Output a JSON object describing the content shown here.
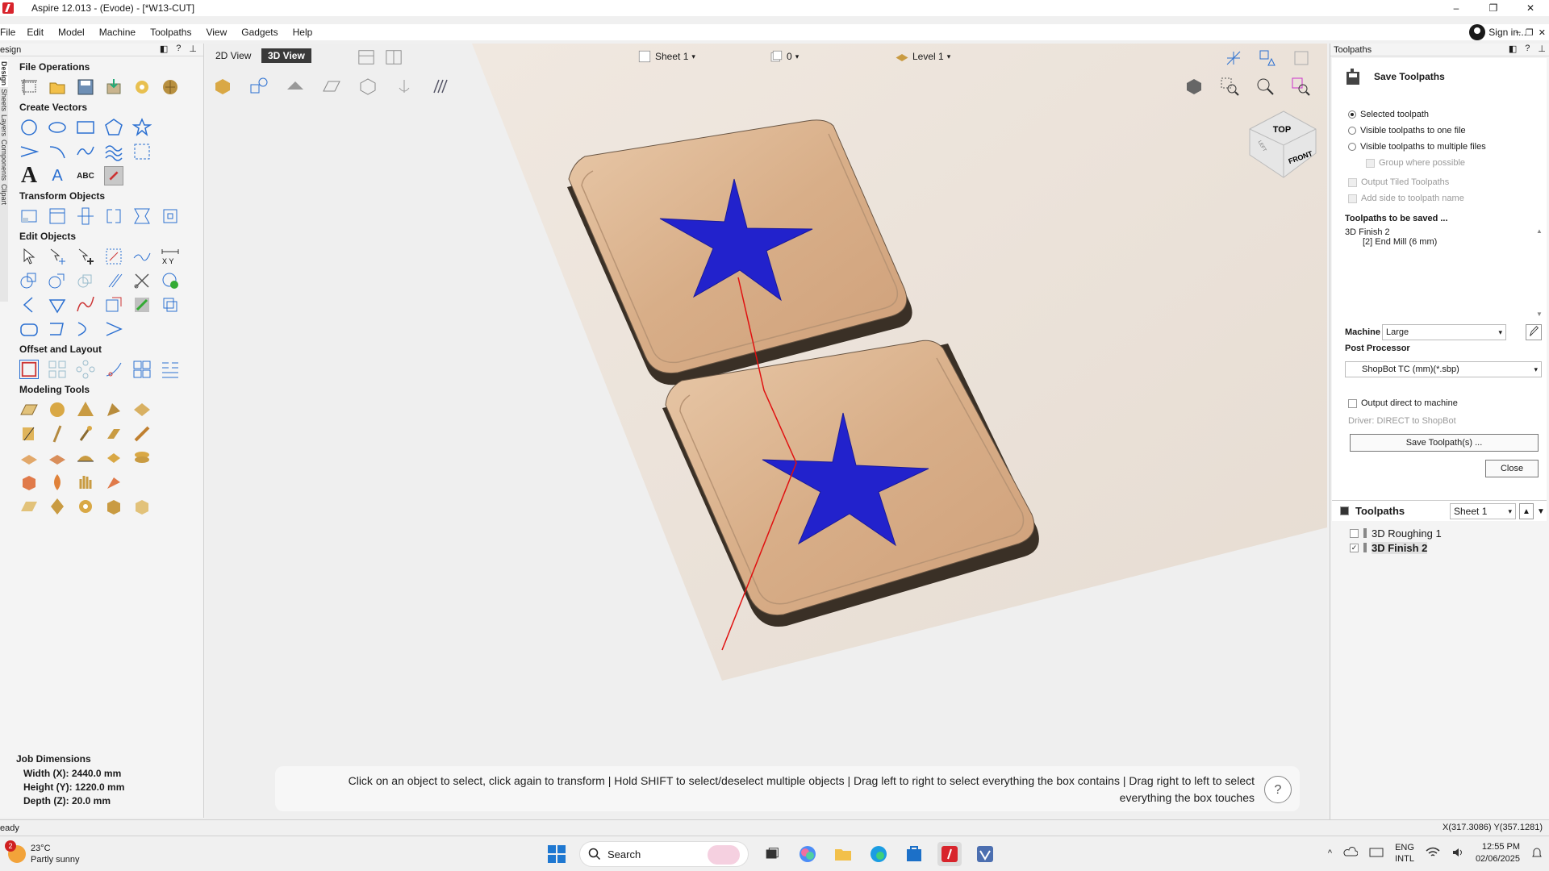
{
  "window": {
    "title": "Aspire 12.013 - (Evode) - [*W13-CUT]",
    "minimize": "–",
    "restore": "❐",
    "close": "✕"
  },
  "menu": {
    "items": [
      "File",
      "Edit",
      "Model",
      "Machine",
      "Toolpaths",
      "View",
      "Gadgets",
      "Help"
    ],
    "sign_in": "Sign in...",
    "extra": [
      "–",
      "❐",
      "✕"
    ]
  },
  "left_panel": {
    "header": "esign",
    "header_ctrls": [
      "◧",
      "?",
      "⊥"
    ],
    "vtabs": [
      "Design",
      "Sheets",
      "Layers",
      "Components",
      "Clipart"
    ],
    "sections": {
      "file_operations": "File Operations",
      "create_vectors": "Create Vectors",
      "transform_objects": "Transform Objects",
      "edit_objects": "Edit Objects",
      "offset_layout": "Offset and Layout",
      "modeling_tools": "Modeling Tools"
    },
    "text_tool_glyph": "A",
    "text_tool_glyph2": "A",
    "abc_glyph": "ABC",
    "xy_glyph": "X Y",
    "job_dimensions": {
      "title": "Job Dimensions",
      "width": "Width  (X): 2440.0 mm",
      "height": "Height (Y): 1220.0 mm",
      "depth": "Depth  (Z): 20.0 mm"
    }
  },
  "view": {
    "tab_2d": "2D View",
    "tab_3d": "3D View",
    "sheet": "Sheet 1",
    "sheet_count": "0",
    "level": "Level 1",
    "cube_top": "TOP",
    "cube_front": "FRONT",
    "cube_left": "LEFT",
    "hint_line1": "Click on an object to select, click again to transform | Hold SHIFT to select/deselect multiple objects | Drag left to right to select everything the box contains | Drag right to left to select",
    "hint_line2": "everything the box touches",
    "help": "?"
  },
  "toolpaths_panel": {
    "header": "Toolpaths",
    "header_ctrls": [
      "◧",
      "?",
      "⊥"
    ],
    "save_title": "Save Toolpaths",
    "options": {
      "selected": "Selected toolpath",
      "one_file": "Visible toolpaths to one file",
      "multiple": "Visible toolpaths to multiple files",
      "group": "Group where possible",
      "tiled": "Output Tiled Toolpaths",
      "side": "Add side to toolpath name"
    },
    "to_be_saved_label": "Toolpaths to be saved ...",
    "to_be_saved": [
      "3D Finish 2",
      "[2] End Mill (6 mm)"
    ],
    "machine_label": "Machine",
    "machine_value": "Large",
    "post_label": "Post Processor",
    "post_value": "ShopBot TC (mm)(*.sbp)",
    "direct_label": "Output direct to machine",
    "driver": "Driver: DIRECT to ShopBot",
    "save_btn": "Save Toolpath(s) ...",
    "close_btn": "Close",
    "list_title": "Toolpaths",
    "list_sheet": "Sheet 1",
    "items": [
      {
        "name": "3D Roughing 1",
        "checked": ""
      },
      {
        "name": "3D Finish 2",
        "checked": "✓"
      }
    ]
  },
  "status": {
    "left": "eady",
    "coords": "X(317.3086) Y(357.1281)"
  },
  "taskbar": {
    "badge": "2",
    "temp": "23°C",
    "weather": "Partly sunny",
    "search": "Search",
    "lang1": "ENG",
    "lang2": "INTL",
    "time": "12:55 PM",
    "date": "02/06/2025",
    "tray_chevron": "^"
  },
  "colors": {
    "accent_red": "#d8242c",
    "star_blue": "#2222cc",
    "wood": "#d9b08c",
    "active_tab": "#3a3a3a"
  }
}
